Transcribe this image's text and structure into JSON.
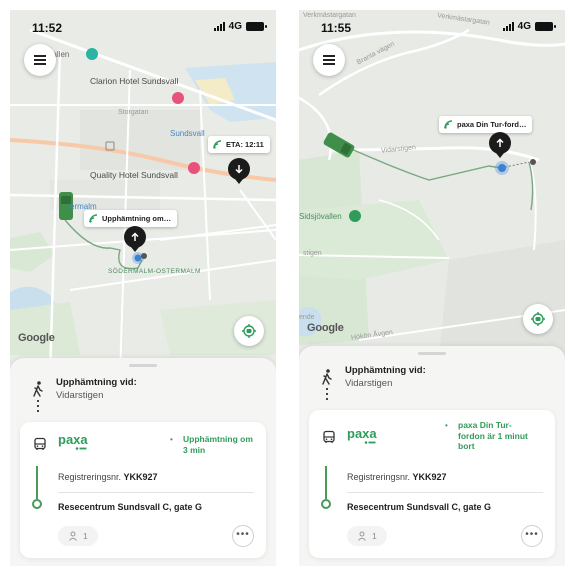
{
  "screens": [
    {
      "status": {
        "time": "11:52",
        "network": "4G"
      },
      "map": {
        "labels": {
          "hallen": "hallen",
          "clarion": "Clarion Hotel Sundsvall",
          "storgatan": "Storgatan",
          "sundsvall": "Sundsvall",
          "quality": "Quality Hotel Sundsvall",
          "ermalm": "ermalm",
          "sodermalm": "SÖDERMALM-OSTERMALM"
        },
        "eta_callout": "ETA: 12:11",
        "vehicle_callout": "Upphämtning om…",
        "google": "Google"
      },
      "pickup": {
        "title": "Upphämtning vid:",
        "place": "Vidarstigen"
      },
      "card": {
        "brand": "paxa",
        "eta_line1": "Upphämtning om",
        "eta_line2": "3 min",
        "reg_label": "Registreringsnr.",
        "reg_value": "YKK927",
        "destination": "Resecentrum Sundsvall C, gate G",
        "passengers": "1",
        "more": "•••"
      }
    },
    {
      "status": {
        "time": "11:55",
        "network": "4G"
      },
      "map": {
        "labels": {
          "verkmastargatan": "Verkmästargatan",
          "verkmastar2": "Verkmästargatan",
          "branta": "Branta vägen",
          "vidarstigen": "Vidarstigen",
          "sidsjovallen": "Sidsjövallen",
          "stigen": "stigen",
          "ende": "ende",
          "vagen": "Hökön Åvgen"
        },
        "vehicle_callout": "paxa Din Tur-ford…",
        "google": "Google"
      },
      "pickup": {
        "title": "Upphämtning vid:",
        "place": "Vidarstigen"
      },
      "card": {
        "brand": "paxa",
        "eta_line1": "paxa Din Tur-",
        "eta_line2": "fordon är 1 minut",
        "eta_line3": "bort",
        "reg_label": "Registreringsnr.",
        "reg_value": "YKK927",
        "destination": "Resecentrum Sundsvall C, gate G",
        "passengers": "1",
        "more": "•••"
      }
    }
  ],
  "colors": {
    "accent_green": "#2f9c5a",
    "route_green": "#4a9a58",
    "pin_black": "#1b1b1b",
    "poi_pink": "#e8527a",
    "poi_teal": "#2bb3a3"
  },
  "icons": [
    "hamburger-menu-icon",
    "locate-car-icon",
    "walking-person-icon",
    "bus-icon",
    "person-icon",
    "more-icon",
    "arrow-up-icon",
    "arrow-down-icon",
    "signal-wave-icon"
  ]
}
